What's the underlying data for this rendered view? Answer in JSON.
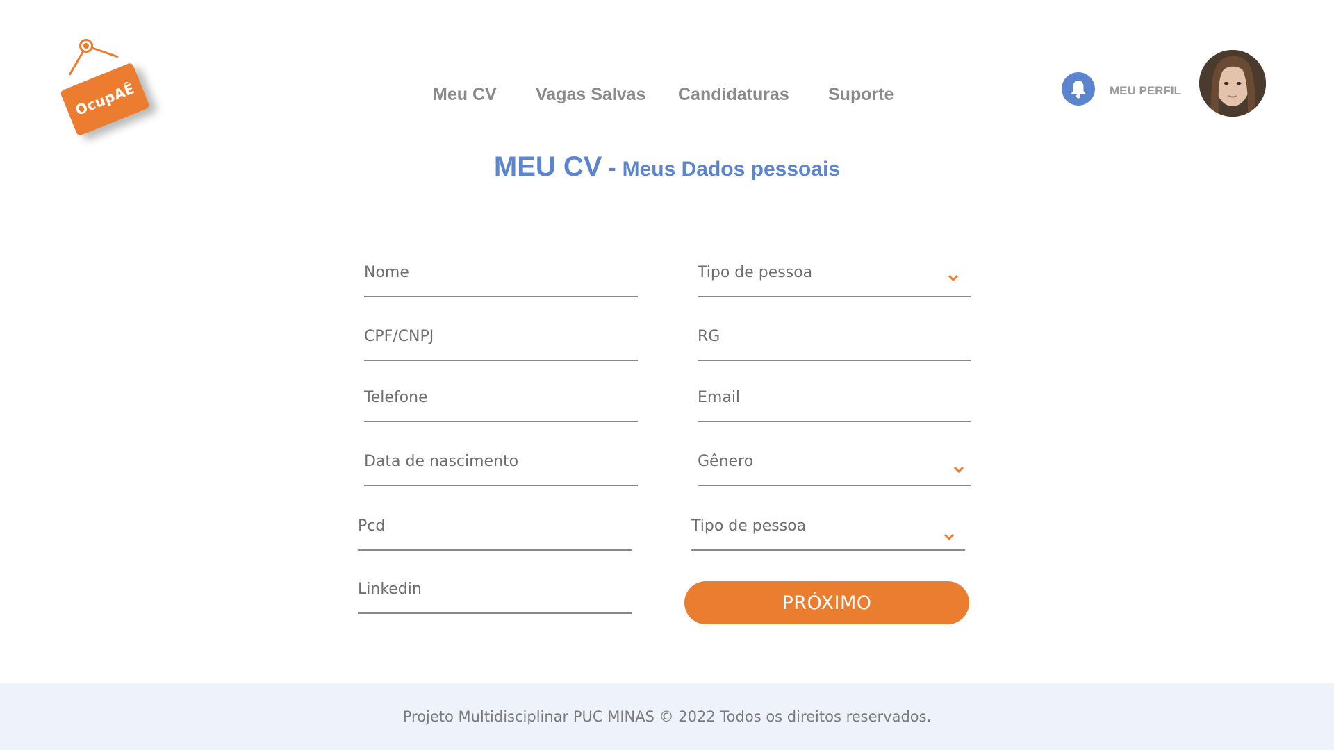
{
  "brand": {
    "logo_text": "OcupAÊ",
    "accent": "#ec7c2f"
  },
  "nav": [
    {
      "label": "Meu CV"
    },
    {
      "label": "Vagas Salvas"
    },
    {
      "label": "Candidaturas"
    },
    {
      "label": "Suporte"
    }
  ],
  "header": {
    "notification_icon": "bell-icon",
    "profile_label": "MEU PERFIL",
    "avatar": "user-photo"
  },
  "title": {
    "main": "MEU CV",
    "separator": "-",
    "sub": "Meus Dados pessoais",
    "color": "#5b86cf"
  },
  "form": {
    "fields": [
      {
        "label": "Nome",
        "type": "text"
      },
      {
        "label": "Tipo  de pessoa",
        "type": "select"
      },
      {
        "label": "CPF/CNPJ",
        "type": "text"
      },
      {
        "label": "RG",
        "type": "text"
      },
      {
        "label": "Telefone",
        "type": "text"
      },
      {
        "label": "Email",
        "type": "text"
      },
      {
        "label": "Data de nascimento",
        "type": "text"
      },
      {
        "label": "Gênero",
        "type": "select"
      },
      {
        "label": "Pcd",
        "type": "text"
      },
      {
        "label": "Tipo  de pessoa",
        "type": "select"
      },
      {
        "label": "Linkedin",
        "type": "text"
      }
    ],
    "submit_label": "PRÓXIMO",
    "submit_color": "#ea7d2f"
  },
  "footer": {
    "text": "Projeto Multidisciplinar  PUC MINAS © 2022 Todos os direitos reservados.",
    "background": "#eef2fa"
  }
}
